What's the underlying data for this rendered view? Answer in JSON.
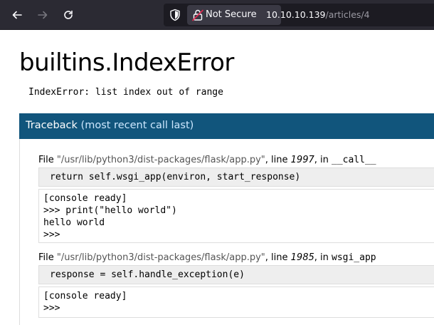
{
  "browser": {
    "back_icon": "arrow-left-icon",
    "forward_icon": "arrow-right-icon",
    "reload_icon": "reload-icon",
    "tracking_icon": "shield-icon",
    "insecure_icon": "broken-lock-icon",
    "security_label": "Not Secure",
    "url_host": "10.10.10.139",
    "url_path": "/articles/4"
  },
  "page": {
    "title": "builtins.IndexError",
    "error_message": "IndexError: list index out of range",
    "traceback_title": "Traceback",
    "traceback_subtitle": "(most recent call last)"
  },
  "frames": [
    {
      "file_prefix": "File ",
      "file_path": "\"/usr/lib/python3/dist-packages/flask/app.py\"",
      "line_prefix": ", line ",
      "line_number": "1997",
      "in_prefix": ", in ",
      "function": "__call__",
      "code": "return self.wsgi_app(environ, start_response)",
      "console": [
        "[console ready]",
        ">>> print(\"hello world\")",
        "hello world",
        ">>>"
      ]
    },
    {
      "file_prefix": "File ",
      "file_path": "\"/usr/lib/python3/dist-packages/flask/app.py\"",
      "line_prefix": ", line ",
      "line_number": "1985",
      "in_prefix": ", in ",
      "function": "wsgi_app",
      "code": "response = self.handle_exception(e)",
      "console": [
        "[console ready]",
        ">>>"
      ]
    }
  ],
  "colors": {
    "toolbar": "#2b2a33",
    "traceback_header": "#11557c",
    "code_background": "#eeeeee"
  }
}
